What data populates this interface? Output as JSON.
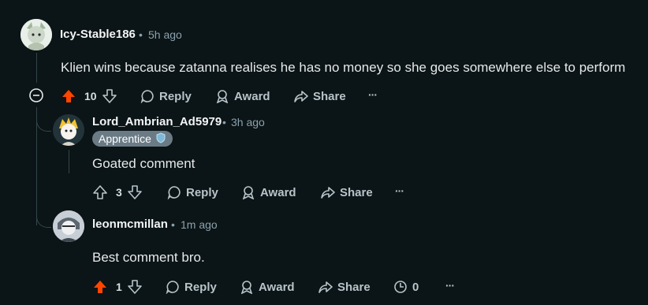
{
  "comments": [
    {
      "user": "Icy-Stable186",
      "dot": "•",
      "time": "5h ago",
      "text": "Klien wins because zatanna realises he has no money so she goes somewhere else to perform",
      "votes": "10",
      "vote_state": "upvoted",
      "actions": {
        "reply": "Reply",
        "award": "Award",
        "share": "Share",
        "more": "···"
      }
    },
    {
      "user": "Lord_Ambrian_Ad5979",
      "dot": "•",
      "time": "3h ago",
      "flair": "Apprentice",
      "text": "Goated comment",
      "votes": "3",
      "vote_state": "none",
      "actions": {
        "reply": "Reply",
        "award": "Award",
        "share": "Share",
        "more": "···"
      }
    },
    {
      "user": "leonmcmillan",
      "dot": "•",
      "time": "1m ago",
      "text": "Best comment bro.",
      "votes": "1",
      "vote_state": "upvoted",
      "awards_count": "0",
      "actions": {
        "reply": "Reply",
        "award": "Award",
        "share": "Share",
        "more": "···"
      }
    }
  ],
  "colors": {
    "background": "#0b1416",
    "upvote_active": "#ff4500",
    "muted": "#8ba2ad",
    "flair_bg": "#6b7b86",
    "thread_line": "#33464c"
  },
  "icons": {
    "collapse": "collapse-minus-icon",
    "upvote": "arrow-up-icon",
    "downvote": "arrow-down-icon",
    "reply": "speech-bubble-icon",
    "award": "award-ribbon-icon",
    "share": "share-arrow-icon",
    "more": "ellipsis-icon",
    "timer": "timer-icon",
    "flair_emoji": "shield-badge-icon"
  }
}
